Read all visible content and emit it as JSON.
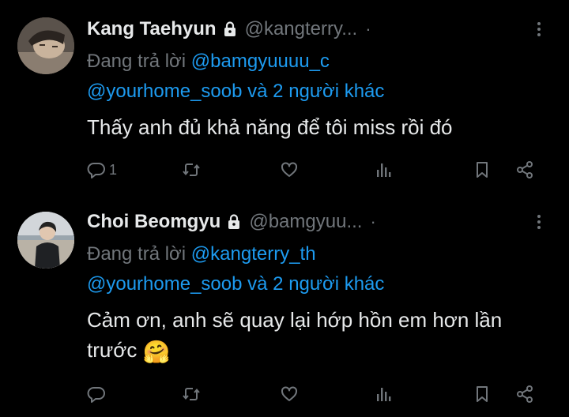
{
  "colors": {
    "background": "#000000",
    "text_primary": "#e7e9ea",
    "text_secondary": "#71767b",
    "link": "#1d9bf0"
  },
  "tweets": [
    {
      "name": "Kang Taehyun",
      "handle": "@kangterry...",
      "separator": "·",
      "reply_prefix": "Đang trả lời",
      "reply_to": "@bamgyuuuu_c",
      "mentions": "@yourhome_soob",
      "mentions_suffix": "và 2 người khác",
      "text": "Thấy anh đủ khả năng để tôi miss rồi đó",
      "emoji": "",
      "reply_count": "1",
      "icons": [
        "lock-icon",
        "more-icon",
        "reply-icon",
        "retweet-icon",
        "like-icon",
        "views-icon",
        "bookmark-icon",
        "share-icon"
      ]
    },
    {
      "name": "Choi Beomgyu",
      "handle": "@bamgyuu...",
      "separator": "·",
      "reply_prefix": "Đang trả lời",
      "reply_to": "@kangterry_th",
      "mentions": "@yourhome_soob",
      "mentions_suffix": "và 2 người khác",
      "text": "Cảm ơn, anh sẽ quay lại hớp hồn em hơn lần trước",
      "emoji": "🤗",
      "reply_count": "",
      "icons": [
        "lock-icon",
        "more-icon",
        "reply-icon",
        "retweet-icon",
        "like-icon",
        "views-icon",
        "bookmark-icon",
        "share-icon"
      ]
    }
  ]
}
